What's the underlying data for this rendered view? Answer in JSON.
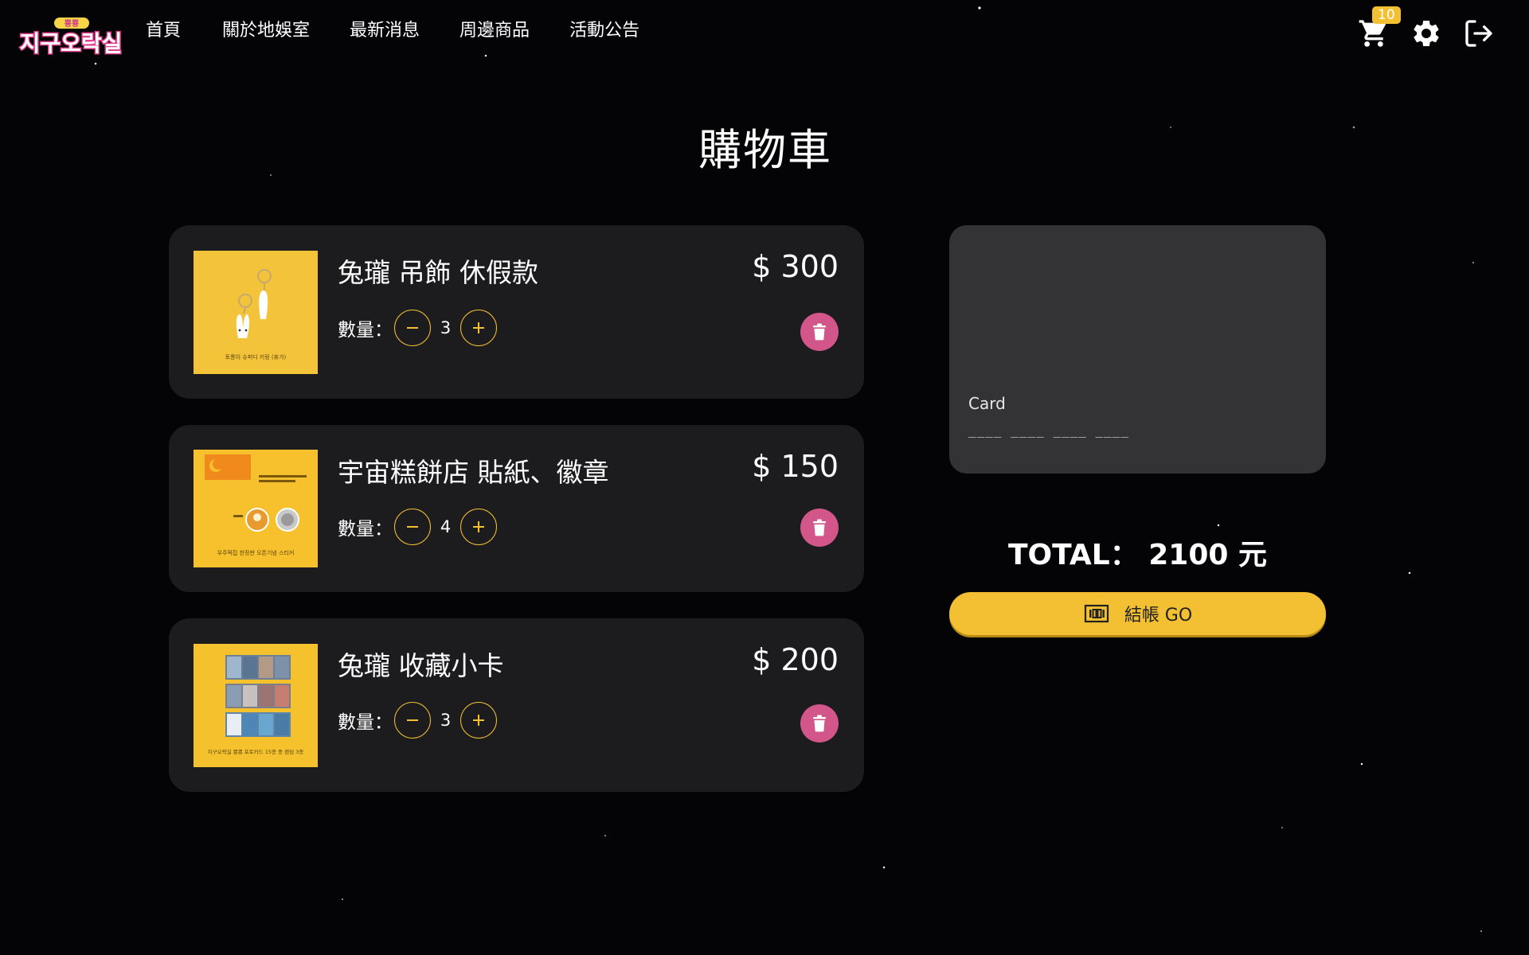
{
  "nav": {
    "logo_text": "지구오락실",
    "logo_small": "뿅뿅",
    "links": [
      "首頁",
      "關於地娛室",
      "最新消息",
      "周邊商品",
      "活動公告"
    ],
    "cart_count": "10",
    "icons": [
      "cart-icon",
      "gear-icon",
      "logout-icon"
    ]
  },
  "page": {
    "title": "購物車"
  },
  "cart": {
    "qty_label": "數量：",
    "items": [
      {
        "name": "兔瓏 吊飾 休假款",
        "price": "$ 300",
        "quantity": "3",
        "thumb_caption": "토롱이 슈퍼디 키링 (휴가)"
      },
      {
        "name": "宇宙糕餅店 貼紙、徽章",
        "price": "$ 150",
        "quantity": "4",
        "thumb_caption": "우주떡집 한정판 오픈기념 스티커"
      },
      {
        "name": "兔瓏 收藏小卡",
        "price": "$ 200",
        "quantity": "3",
        "thumb_caption": "지구오락실 뿅뿅 포토카드 15종 중 랜덤 3종"
      }
    ]
  },
  "card": {
    "label": "Card",
    "number": "____ ____ ____ ____"
  },
  "summary": {
    "total": "TOTAL： 2100 元",
    "checkout_label": "結帳 GO"
  },
  "colors": {
    "accent": "#f3c033",
    "delete": "#d2568a",
    "panel": "#1c1c1e",
    "card": "#333335"
  }
}
